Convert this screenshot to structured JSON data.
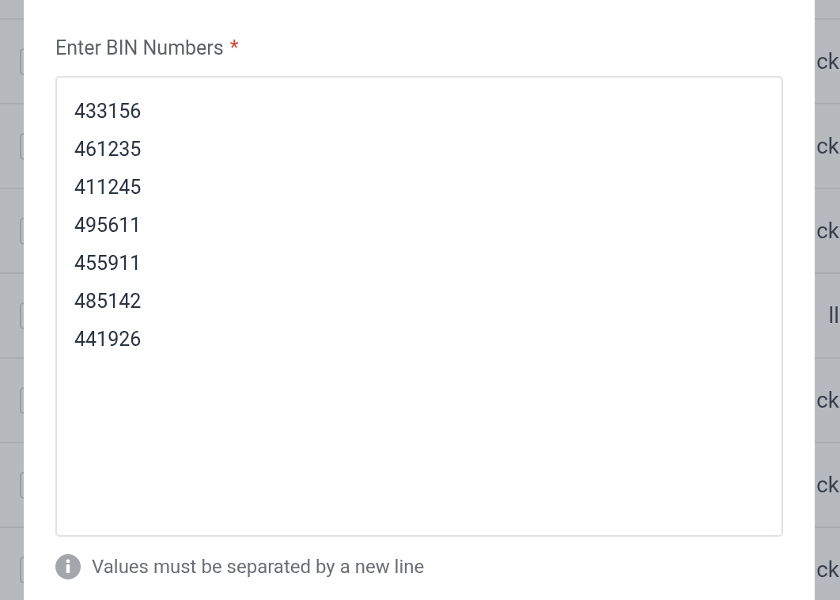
{
  "background_rows": [
    {
      "checked": false,
      "status_text": "ck"
    },
    {
      "checked": false,
      "status_text": "ck"
    },
    {
      "checked": false,
      "status_text": "ck"
    },
    {
      "checked": false,
      "status_text": "ll"
    },
    {
      "checked": false,
      "status_text": "ck"
    },
    {
      "checked": false,
      "status_text": "ck"
    },
    {
      "checked": false,
      "status_text": "ck"
    }
  ],
  "dialog": {
    "bin_field": {
      "label": "Enter BIN Numbers",
      "required_mark": "*",
      "value": [
        "433156",
        "461235",
        "411245",
        "495611",
        "455911",
        "485142",
        "441926"
      ]
    },
    "hint": "Values must be separated by a new line"
  }
}
